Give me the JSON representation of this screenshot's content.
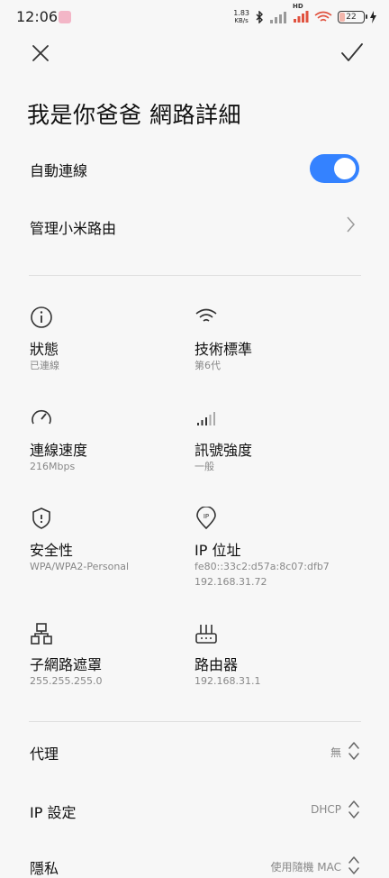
{
  "status_bar": {
    "time": "12:06",
    "speed_value": "1.83",
    "speed_unit": "KB/s",
    "hd": "HD",
    "battery": "22"
  },
  "header": {
    "title": "我是你爸爸 網路詳細"
  },
  "settings": {
    "auto_connect_label": "自動連線",
    "auto_connect_on": true,
    "manage_router_label": "管理小米路由"
  },
  "details": [
    {
      "title": "狀態",
      "value": "已連線",
      "icon": "info-icon"
    },
    {
      "title": "技術標準",
      "value": "第6代",
      "icon": "wifi-icon"
    },
    {
      "title": "連線速度",
      "value": "216Mbps",
      "icon": "speedometer-icon"
    },
    {
      "title": "訊號強度",
      "value": "一般",
      "icon": "signal-bars-icon"
    },
    {
      "title": "安全性",
      "value": "WPA/WPA2-Personal",
      "icon": "shield-icon"
    },
    {
      "title": "IP 位址",
      "value": "fe80::33c2:d57a:8c07:dfb7",
      "value2": "192.168.31.72",
      "icon": "ip-location-icon"
    },
    {
      "title": "子網路遮罩",
      "value": "255.255.255.0",
      "icon": "network-tree-icon"
    },
    {
      "title": "路由器",
      "value": "192.168.31.1",
      "icon": "router-icon"
    }
  ],
  "properties": {
    "proxy_label": "代理",
    "proxy_value": "無",
    "ip_setting_label": "IP 設定",
    "ip_setting_value": "DHCP",
    "partial_label": "隱私",
    "partial_value": "使用隨機 MAC"
  },
  "colors": {
    "accent": "#3482ff",
    "background": "#f7f7f7"
  }
}
